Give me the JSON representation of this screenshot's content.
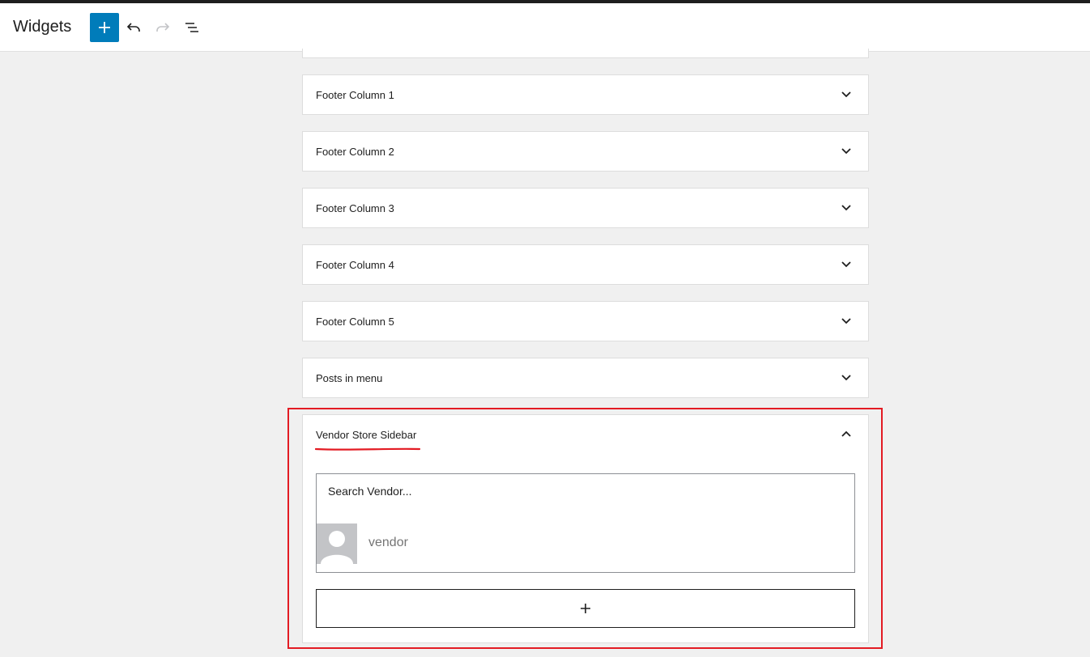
{
  "header": {
    "title": "Widgets",
    "buttons": {
      "add": "add-block-icon",
      "undo": "undo-icon",
      "redo": "redo-icon",
      "list_view": "list-view-icon"
    },
    "colors": {
      "accent": "#007cba",
      "topbar": "#1e1e1e"
    }
  },
  "areas": [
    {
      "title": "Footer Column 1",
      "expanded": false
    },
    {
      "title": "Footer Column 2",
      "expanded": false
    },
    {
      "title": "Footer Column 3",
      "expanded": false
    },
    {
      "title": "Footer Column 4",
      "expanded": false
    },
    {
      "title": "Footer Column 5",
      "expanded": false
    },
    {
      "title": "Posts in menu",
      "expanded": false
    },
    {
      "title": "Vendor Store Sidebar",
      "expanded": true
    }
  ],
  "vendor_widget": {
    "search_placeholder": "Search Vendor...",
    "vendor_name": "vendor"
  },
  "annotation": {
    "color": "#e31b23"
  }
}
